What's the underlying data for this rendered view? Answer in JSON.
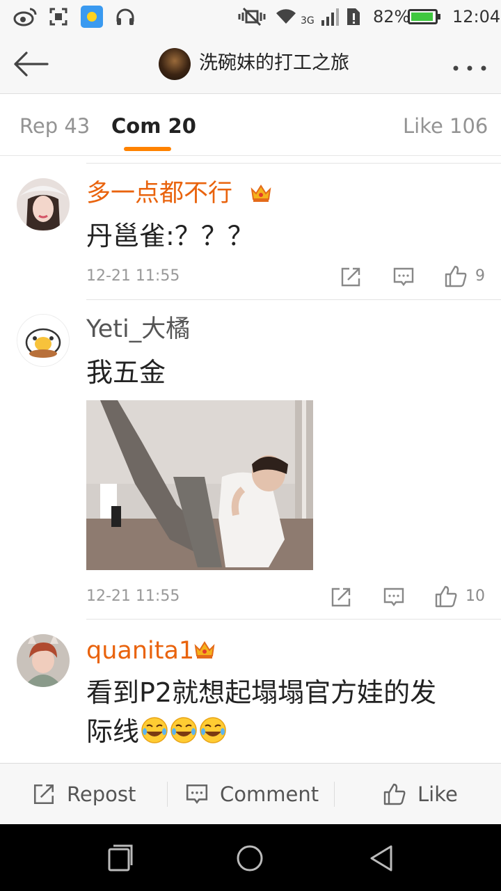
{
  "status_bar": {
    "battery": "82%",
    "network": "3G",
    "time": "12:04"
  },
  "header": {
    "title": "洗碗妹的打工之旅"
  },
  "tabs": [
    {
      "label": "Rep 43"
    },
    {
      "label": "Com 20"
    },
    {
      "label": "Like 106"
    }
  ],
  "comments": [
    {
      "username": "多一点都不行",
      "text": "丹邕雀:？？？",
      "time": "12-21 11:55",
      "likes": "9"
    },
    {
      "username": "Yeti_大橘",
      "text": "我五金",
      "time": "12-21 11:55",
      "likes": "10"
    },
    {
      "username": "quanita1",
      "text_line1": "看到P2就想起塌塌官方娃的发",
      "text_line2": "际线"
    }
  ],
  "toolbar": {
    "repost": "Repost",
    "comment": "Comment",
    "like": "Like"
  },
  "colors": {
    "accent": "#ff8200",
    "vip_name": "#e9630d",
    "normal_name": "#555555"
  }
}
